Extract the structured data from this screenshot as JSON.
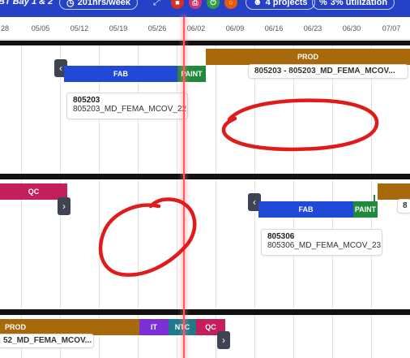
{
  "toolbar": {
    "title": "BT Bay 1 & 2",
    "hours_label": "201hrs/week",
    "projects_label": "4 projects",
    "utilization_label": "3% utilization"
  },
  "timeline": {
    "dates": [
      "28",
      "05/05",
      "05/12",
      "05/19",
      "05/26",
      "06/02",
      "06/09",
      "06/16",
      "06/23",
      "06/30",
      "07/07"
    ]
  },
  "row1": {
    "fab_label": "FAB",
    "paint_label": "PAINT",
    "prod_label": "PROD",
    "prod_card": "805203 - 805203_MD_FEMA_MCOV...",
    "card_id": "805203",
    "card_name": "805203_MD_FEMA_MCOV_22"
  },
  "row2": {
    "qc_label": "QC",
    "fab_label": "FAB",
    "paint_label": "PAINT",
    "edge_card": "8",
    "card_id": "805306",
    "card_name": "805306_MD_FEMA_MCOV_23"
  },
  "row3": {
    "prod_label": "PROD",
    "it_label": "IT",
    "ntc_label": "NTC",
    "qc_label": "QC",
    "prod_card": "52_MD_FEMA_MCOV..."
  },
  "colors": {
    "header": "#2542c6",
    "fab": "#2149d8",
    "paint": "#1f8a3c",
    "prod": "#a8690c",
    "qc": "#c41f5c",
    "it": "#7c2fd6",
    "ntc": "#1f7a8c",
    "annotation": "#e01b1b",
    "today_line": "#ff5a5a"
  },
  "icons": [
    "arrows-icon",
    "trash-icon",
    "print-icon",
    "power-icon",
    "stop-icon",
    "users-icon",
    "percent-icon",
    "chevron-left-icon",
    "chevron-right-icon"
  ]
}
